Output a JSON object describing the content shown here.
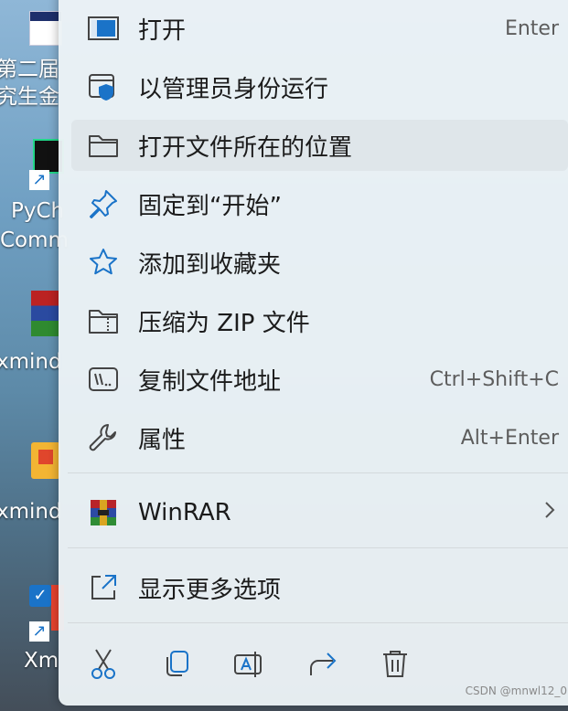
{
  "desktop": {
    "labels": [
      "第二届",
      "究生金",
      "PyCh",
      "Comm",
      "xmind",
      "xmind",
      "Xm"
    ]
  },
  "menu": {
    "items": [
      {
        "label": "打开",
        "shortcut": "Enter",
        "icon": "open-window-icon"
      },
      {
        "label": "以管理员身份运行",
        "shortcut": "",
        "icon": "admin-shield-icon"
      },
      {
        "label": "打开文件所在的位置",
        "shortcut": "",
        "icon": "folder-icon"
      },
      {
        "label": "固定到“开始”",
        "shortcut": "",
        "icon": "pin-icon"
      },
      {
        "label": "添加到收藏夹",
        "shortcut": "",
        "icon": "star-icon"
      },
      {
        "label": "压缩为 ZIP 文件",
        "shortcut": "",
        "icon": "zip-folder-icon"
      },
      {
        "label": "复制文件地址",
        "shortcut": "Ctrl+Shift+C",
        "icon": "copy-path-icon"
      },
      {
        "label": "属性",
        "shortcut": "Alt+Enter",
        "icon": "wrench-icon"
      }
    ],
    "winrar": {
      "label": "WinRAR",
      "icon": "winrar-icon",
      "submenu_icon": "chevron-right-icon"
    },
    "more": {
      "label": "显示更多选项",
      "icon": "show-more-icon"
    },
    "toolbar": [
      "cut-icon",
      "copy-icon",
      "rename-icon",
      "share-icon",
      "delete-icon"
    ]
  },
  "watermark": "CSDN @mnwl12_0",
  "colors": {
    "accent": "#1a73c8",
    "menu_bg": "#ecf3f6",
    "hover_bg": "#dfe6ea"
  }
}
